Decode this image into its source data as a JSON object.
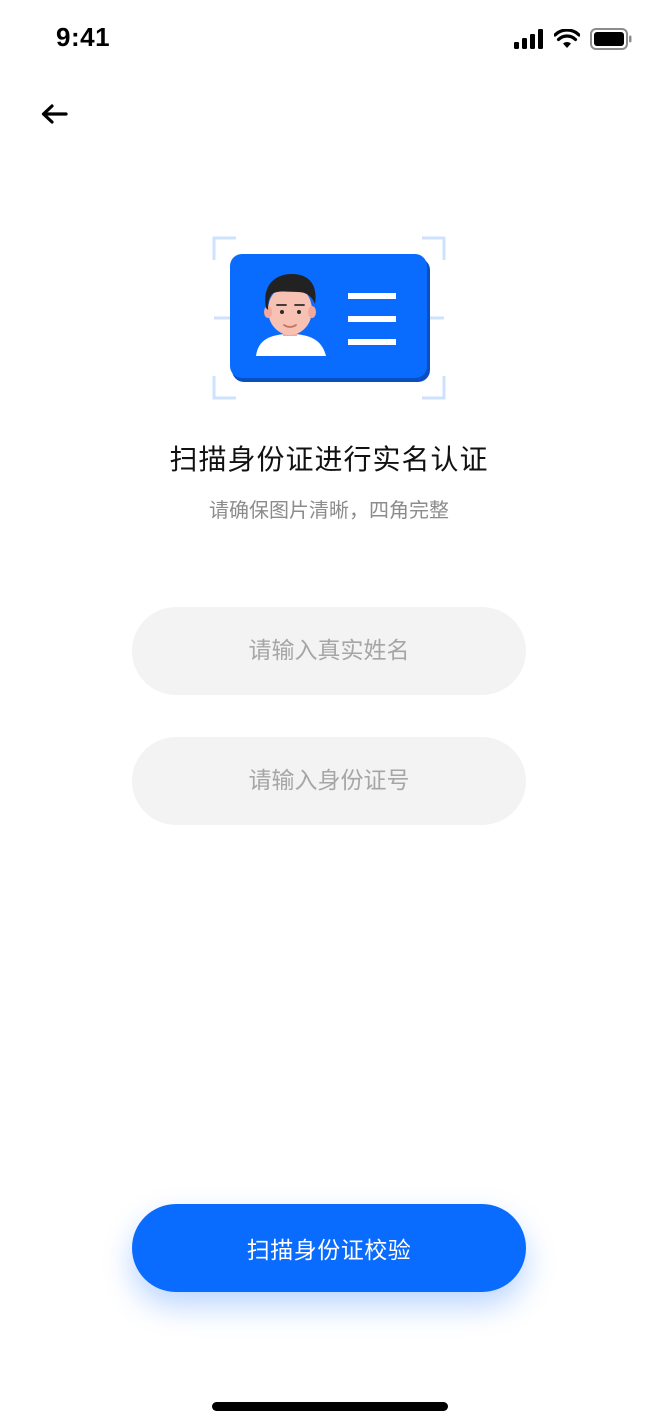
{
  "status_bar": {
    "time": "9:41",
    "icons": [
      "signal-icon",
      "wifi-icon",
      "battery-icon"
    ]
  },
  "nav": {
    "back_icon": "arrow-left-icon"
  },
  "illustration": {
    "icon": "id-card-icon",
    "card_color": "#0a6cff"
  },
  "content": {
    "title": "扫描身份证进行实名认证",
    "subtitle": "请确保图片清晰，四角完整"
  },
  "form": {
    "name_placeholder": "请输入真实姓名",
    "name_value": "",
    "id_placeholder": "请输入身份证号",
    "id_value": ""
  },
  "actions": {
    "scan_button_label": "扫描身份证校验"
  },
  "colors": {
    "accent": "#0a6cff",
    "input_bg": "#f3f3f3",
    "placeholder": "#a6a6a6",
    "subtitle": "#8c8c8c"
  }
}
